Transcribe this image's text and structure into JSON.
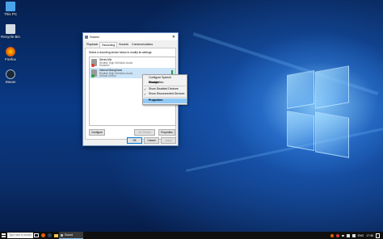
{
  "desktop": {
    "icons": [
      {
        "label": "This PC",
        "icon": "computer-icon",
        "color": "#4aa3e8"
      },
      {
        "label": "Recycle Bin",
        "icon": "recycle-bin-icon",
        "color": "#d6dde4"
      },
      {
        "label": "Firefox",
        "icon": "firefox-icon",
        "color": "#e66000"
      },
      {
        "label": "Steam",
        "icon": "steam-icon",
        "color": "#1b2838"
      }
    ]
  },
  "dialog": {
    "title": "Sound",
    "close": "✕",
    "tabs": [
      "Playback",
      "Recording",
      "Sounds",
      "Communications"
    ],
    "active_tab": "Recording",
    "instruction": "Select a recording device below to modify its settings:",
    "devices": [
      {
        "name": "Stereo Mix",
        "sub1": "Realtek High Definition Audio",
        "sub2": "Disabled",
        "status": "red"
      },
      {
        "name": "Internal Microphone",
        "sub1": "Realtek High Definition Audio",
        "sub2": "Default Device",
        "status": "green"
      }
    ],
    "buttons": {
      "configure": "Configure",
      "set_default": "Set Default",
      "properties": "Properties",
      "ok": "OK",
      "cancel": "Cancel",
      "apply": "Apply"
    }
  },
  "context_menu": {
    "items": [
      {
        "label": "Configure Speech Recognition",
        "checked": false,
        "highlighted": false
      },
      {
        "label": "Disable",
        "checked": false,
        "highlighted": false
      },
      {
        "label": "Show Disabled Devices",
        "checked": true,
        "highlighted": false
      },
      {
        "label": "Show Disconnected Devices",
        "checked": true,
        "highlighted": false
      },
      {
        "label": "Properties",
        "checked": false,
        "highlighted": true
      }
    ]
  },
  "taskbar": {
    "search_placeholder": "Type here to search",
    "active_app": "Sound",
    "language": "ENG",
    "time": "17:36"
  }
}
